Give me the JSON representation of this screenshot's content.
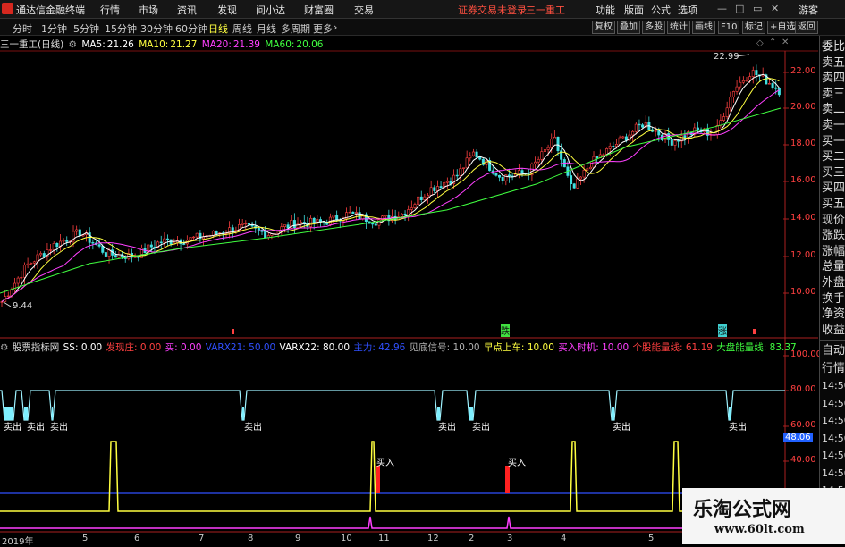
{
  "topbar": {
    "app_title": "通达信金融终端",
    "menus": [
      "行情",
      "市场",
      "资讯",
      "发现",
      "问小达",
      "财富圈",
      "交易"
    ],
    "login": "证券交易未登录",
    "stock": "三一重工",
    "right_menus": [
      "功能",
      "版面",
      "公式",
      "选项"
    ],
    "guest": "游客",
    "colors": {
      "accent": "#d6281f",
      "login": "#ff5040"
    }
  },
  "periodbar": {
    "periods": [
      "分时",
      "1分钟",
      "5分钟",
      "15分钟",
      "30分钟",
      "60分钟",
      "日线",
      "周线",
      "月线",
      "多周期",
      "更多"
    ],
    "active": "日线",
    "tools": [
      "复权",
      "叠加",
      "多股",
      "统计",
      "画线",
      "F10",
      "标记",
      "+自选",
      "返回"
    ]
  },
  "main_header": {
    "stock_name": "三一重工(日线)",
    "ma5_label": "MA5:",
    "ma5": "21.26",
    "ma10_label": "MA10:",
    "ma10": "21.27",
    "ma20_label": "MA20:",
    "ma20": "21.39",
    "ma60_label": "MA60:",
    "ma60": "20.06",
    "colors": {
      "ma5": "#ffffff",
      "ma10": "#ffff40",
      "ma20": "#ff40ff",
      "ma60": "#40ff40"
    }
  },
  "price_axis": [
    "22.00",
    "20.00",
    "18.00",
    "16.00",
    "14.00",
    "12.00",
    "10.00"
  ],
  "high_label": "22.99",
  "low_label": "9.44",
  "ind_header": {
    "name": "股票指标网",
    "items": [
      {
        "label": "SS: 0.00",
        "color": "#ffffff"
      },
      {
        "label": "发现庄: 0.00",
        "color": "#ff4040"
      },
      {
        "label": "买: 0.00",
        "color": "#ff40ff"
      },
      {
        "label": "VARX21: 50.00",
        "color": "#3050ff"
      },
      {
        "label": "VARX22: 80.00",
        "color": "#ffffff"
      },
      {
        "label": "主力: 42.96",
        "color": "#3050ff"
      },
      {
        "label": "见底信号: 10.00",
        "color": "#b0b0b0"
      },
      {
        "label": "早点上车: 10.00",
        "color": "#ffff40"
      },
      {
        "label": "买入时机: 10.00",
        "color": "#ff40ff"
      },
      {
        "label": "个股能量线: 61.19",
        "color": "#ff4040"
      },
      {
        "label": "大盘能量线: 83.37",
        "color": "#40ff40"
      }
    ]
  },
  "ind_axis": [
    "100.00",
    "80.00",
    "60.00",
    "40.00"
  ],
  "ind_current": "48.06",
  "x_labels": [
    "2019年",
    "5",
    "6",
    "7",
    "8",
    "9",
    "10",
    "11",
    "12",
    "2",
    "3",
    "4",
    "5"
  ],
  "markers": {
    "sell": "卖出",
    "buy": "买入",
    "die": "跌",
    "zhang": "涨"
  },
  "right_panel": {
    "upper": [
      "委比",
      "卖五",
      "卖四",
      "卖三",
      "卖二",
      "卖一",
      "买一",
      "买二",
      "买三",
      "买四",
      "买五",
      "现价",
      "涨跌",
      "涨幅",
      "总量",
      "外盘",
      "换手",
      "净资",
      "收益"
    ],
    "lower": [
      "自动",
      "行情",
      "14:50",
      "14:50",
      "14:50",
      "14:50",
      "14:50",
      "14:50",
      "14:50",
      "14:50",
      "14:50"
    ]
  },
  "watermark": {
    "site": "乐淘公式网",
    "url": "www.60lt.com"
  }
}
